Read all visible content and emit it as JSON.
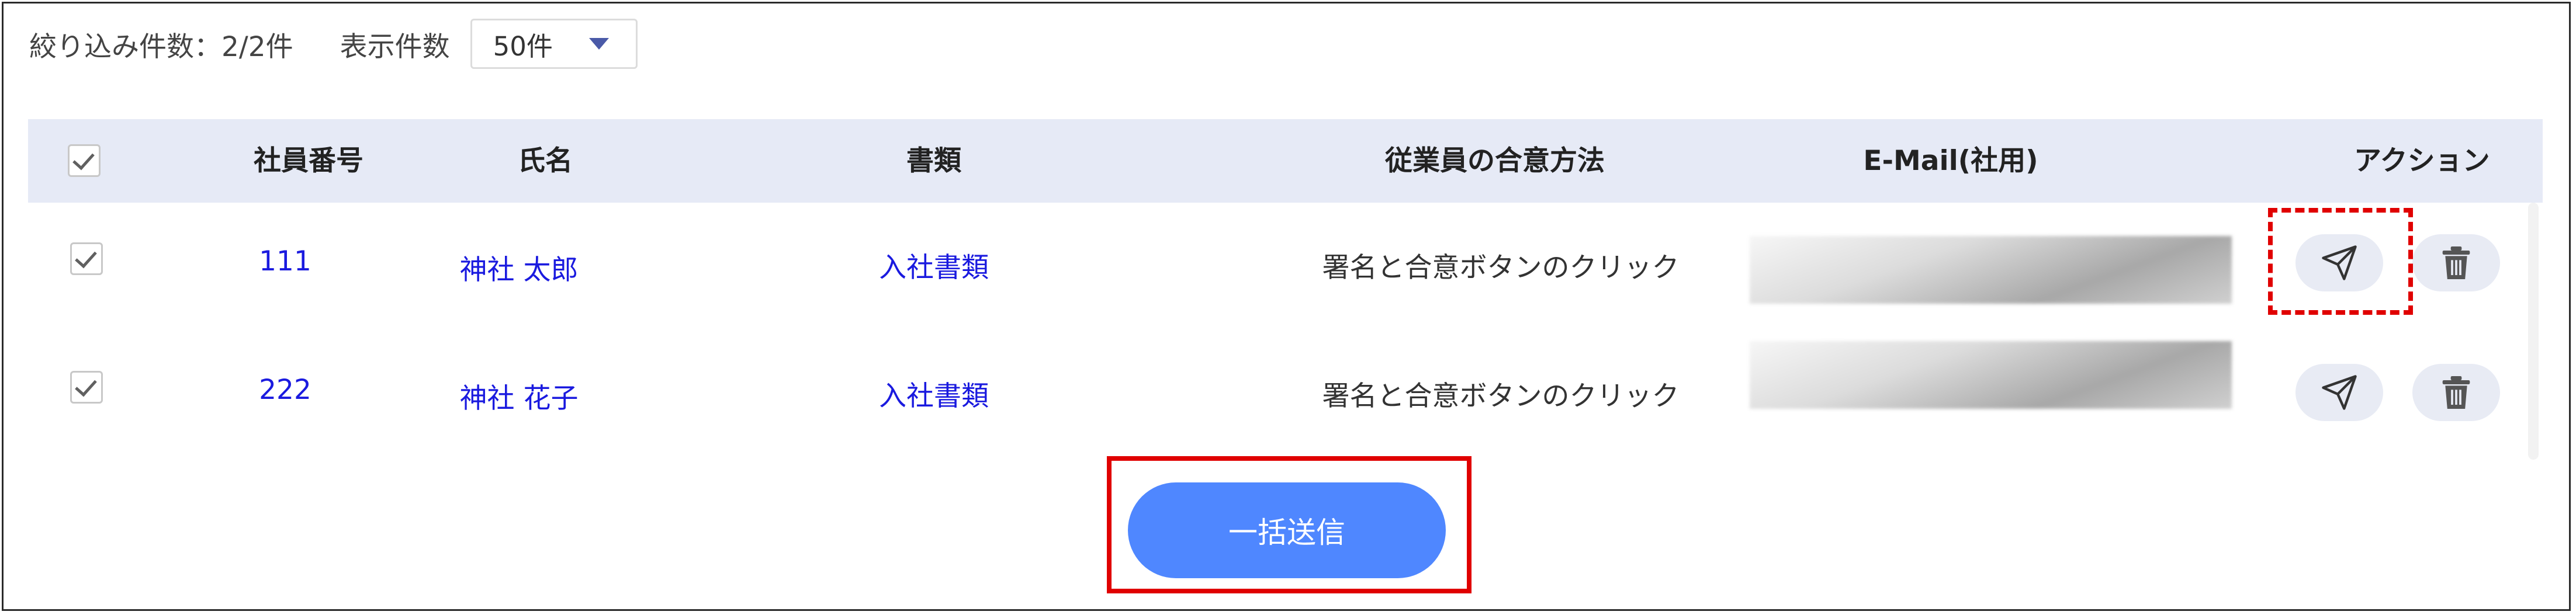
{
  "filter": {
    "count_label": "絞り込み件数：2/2件",
    "per_page_label": "表示件数",
    "per_page_value": "50件"
  },
  "table": {
    "headers": {
      "employee_no": "社員番号",
      "name": "氏名",
      "document": "書類",
      "consent_method": "従業員の合意方法",
      "email": "E-Mail(社用)",
      "action": "アクション"
    },
    "rows": [
      {
        "checked": true,
        "employee_no": "111",
        "name": "神社 太郎",
        "document": "入社書類",
        "consent_method": "署名と合意ボタンのクリック"
      },
      {
        "checked": true,
        "employee_no": "222",
        "name": "神社 花子",
        "document": "入社書類",
        "consent_method": "署名と合意ボタンのクリック"
      }
    ]
  },
  "bulk_send_label": "一括送信",
  "icons": {
    "send": "paper-plane-icon",
    "delete": "trash-icon",
    "dropdown": "caret-down-icon",
    "checkbox": "checkmark-icon"
  },
  "colors": {
    "header_bg": "#e6eaf6",
    "link": "#1a1adf",
    "primary_button": "#4f87ff",
    "highlight_red": "#e00000"
  }
}
